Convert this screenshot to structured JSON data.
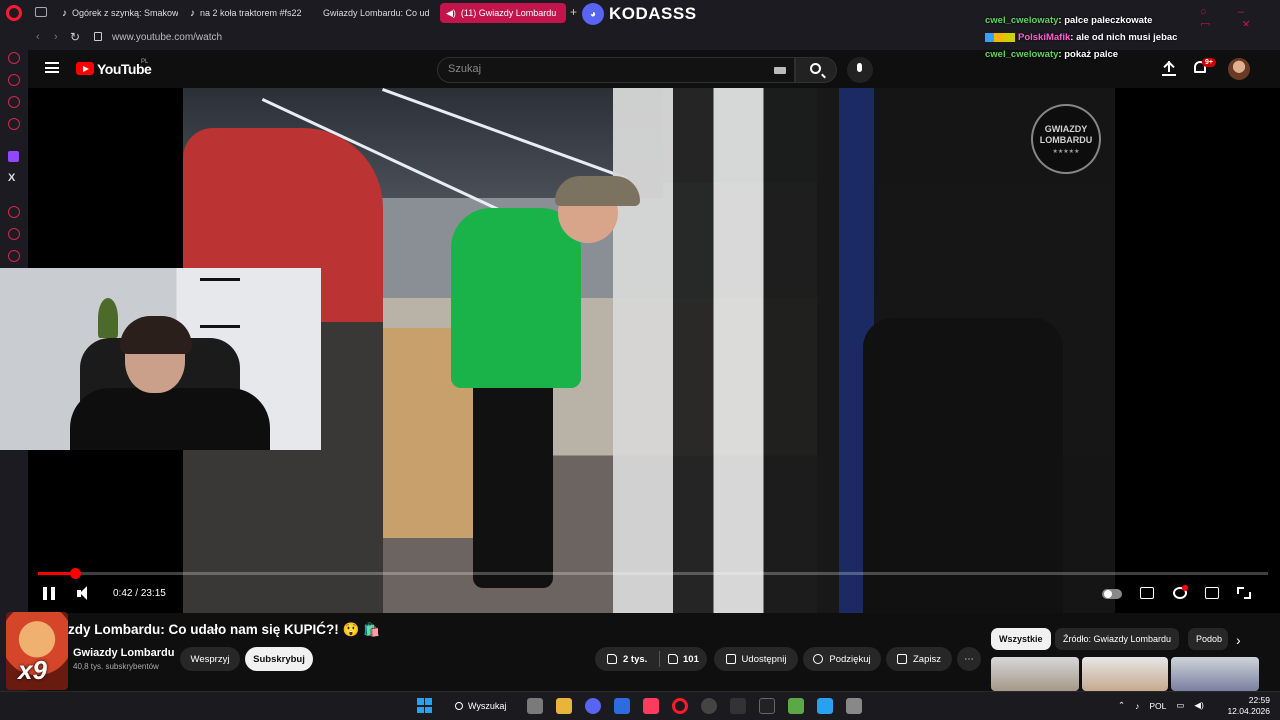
{
  "browser": {
    "tabs": [
      {
        "label": "Ogórek z szynką: Smakow",
        "active": false
      },
      {
        "label": "na 2 koła traktorem #fs22",
        "active": false
      },
      {
        "label": "Gwiazdy Lombardu: Co ud",
        "active": false
      },
      {
        "label": "(11) Gwiazdy Lombardu",
        "active": true
      }
    ],
    "new_tab_label": "+",
    "streamer_name": "KODASSS",
    "url": "www.youtube.com/watch",
    "accent": "#c3154b"
  },
  "chat": [
    {
      "user": "cwel_cwelowaty",
      "message": ": palce paleczkowate",
      "color": "#5bd35b",
      "badges": false
    },
    {
      "user": "PolskiMafik",
      "message": ": ale od nich musi jebac",
      "color": "#ff5fd0",
      "badges": true
    },
    {
      "user": "cwel_cwelowaty",
      "message": ": pokaż palce",
      "color": "#5bd35b",
      "badges": false
    }
  ],
  "youtube": {
    "wordmark": "YouTube",
    "country": "PL",
    "search_placeholder": "Szukaj",
    "notification_count": "9+",
    "brand_color": "#ff0000"
  },
  "video": {
    "watermark_line1": "GWIAZDY",
    "watermark_line2": "LOMBARDU",
    "watermark_stars": "★★★★★",
    "time_current": "0:42",
    "time_separator": " / ",
    "time_total": "23:15",
    "progress_fraction": 0.03
  },
  "details": {
    "title": "zdy Lombardu: Co udało nam się KUPIĆ?! 😲 🛍️",
    "channel": "Gwiazdy Lombardu",
    "subscribers": "40,8 tys. subskrybentów",
    "join_label": "Wesprzyj",
    "subscribe_label": "Subskrybuj",
    "likes": "2 tys.",
    "dislikes": "101",
    "share_label": "Udostępnij",
    "thanks_label": "Podziękuj",
    "save_label": "Zapisz",
    "more_label": "⋯",
    "emote_text": "x9"
  },
  "recommendations": {
    "chips": [
      "Wszystkie",
      "Źródło: Gwiazdy Lombardu",
      "Podob"
    ],
    "active_chip": 0
  },
  "taskbar": {
    "search_label": "Wyszukaj",
    "language": "POL",
    "time": "22:59",
    "date": "12.04.2026"
  }
}
